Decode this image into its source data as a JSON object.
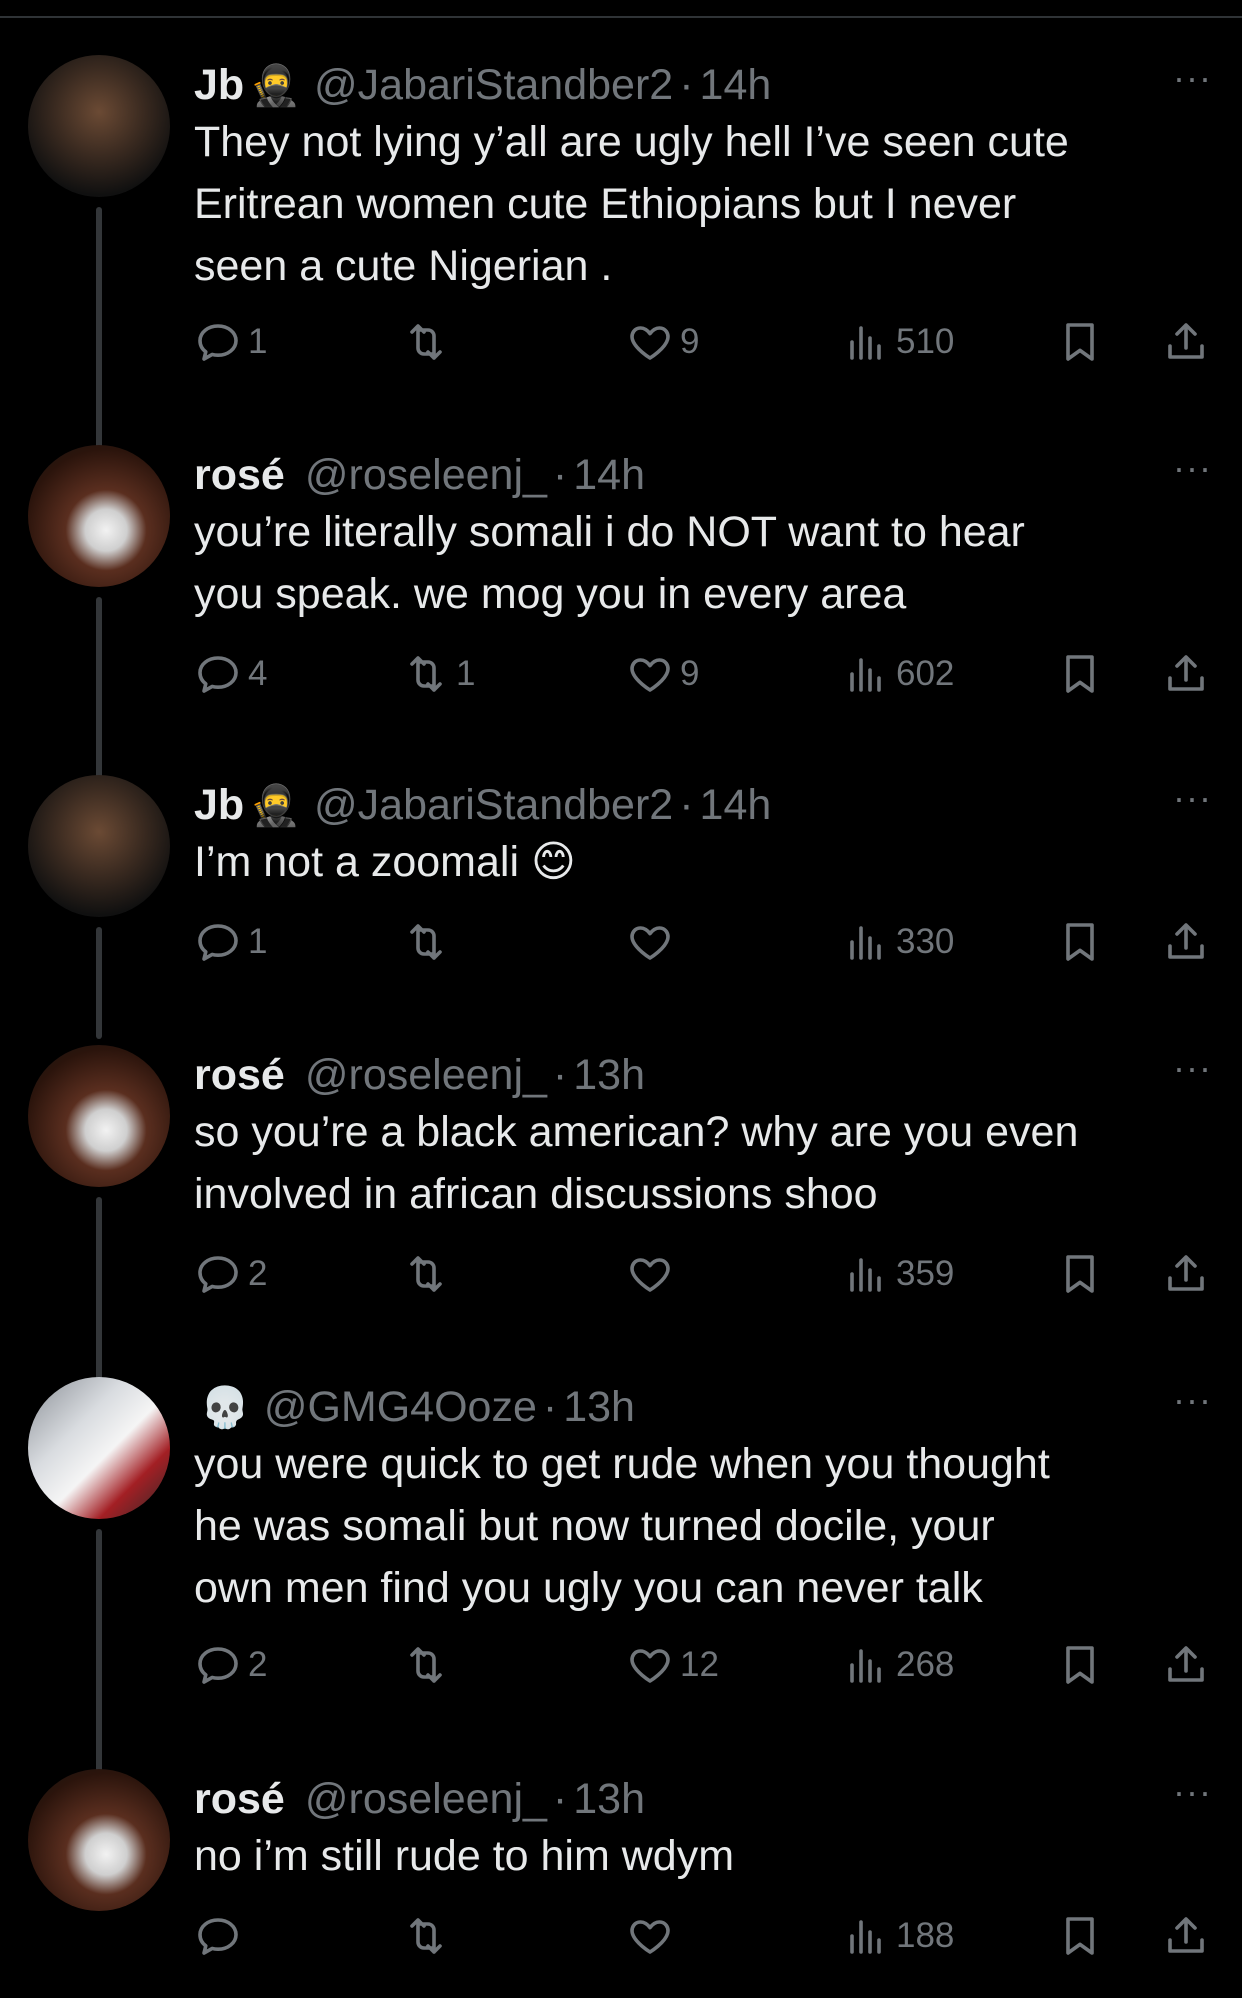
{
  "tweets": [
    {
      "name": "Jb",
      "name_emoji": "🥷",
      "handle": "@JabariStandber2",
      "time": "14h",
      "lines": [
        "They not lying y’all are ugly hell I’ve seen cute",
        "Eritrean women cute Ethiopians but I never",
        "seen a cute Nigerian ."
      ],
      "replies": "1",
      "retweets": "",
      "likes": "9",
      "views": "510",
      "avatar_icon": "jb-avatar"
    },
    {
      "name": "rosé",
      "name_emoji": "",
      "handle": "@roseleenj_",
      "time": "14h",
      "lines": [
        "you’re literally somali i do NOT want to hear",
        "you speak. we mog you in every area"
      ],
      "replies": "4",
      "retweets": "1",
      "likes": "9",
      "views": "602",
      "avatar_icon": "rose-avatar"
    },
    {
      "name": "Jb",
      "name_emoji": "🥷",
      "handle": "@JabariStandber2",
      "time": "14h",
      "lines": [
        "I’m not a zoomali 😊"
      ],
      "replies": "1",
      "retweets": "",
      "likes": "",
      "views": "330",
      "avatar_icon": "jb-avatar"
    },
    {
      "name": "rosé",
      "name_emoji": "",
      "handle": "@roseleenj_",
      "time": "13h",
      "lines": [
        "so you’re a black american? why are you even",
        "involved in african discussions shoo"
      ],
      "replies": "2",
      "retweets": "",
      "likes": "",
      "views": "359",
      "avatar_icon": "rose-avatar"
    },
    {
      "name": "",
      "name_emoji": "💀",
      "handle": "@GMG4Ooze",
      "time": "13h",
      "lines": [
        "you were quick to get rude when you thought",
        "he was somali but now turned docile, your",
        "own men find you ugly you can never talk"
      ],
      "replies": "2",
      "retweets": "",
      "likes": "12",
      "views": "268",
      "avatar_icon": "gmg-avatar"
    },
    {
      "name": "rosé",
      "name_emoji": "",
      "handle": "@roseleenj_",
      "time": "13h",
      "lines": [
        "no i’m still rude to him wdym"
      ],
      "replies": "",
      "retweets": "",
      "likes": "",
      "views": "188",
      "avatar_icon": "rose-avatar"
    }
  ],
  "ui": {
    "separator": "·",
    "more": "···"
  },
  "colors": {
    "background": "#000000",
    "text": "#e7e9ea",
    "muted": "#71767b",
    "connector": "#333639"
  }
}
